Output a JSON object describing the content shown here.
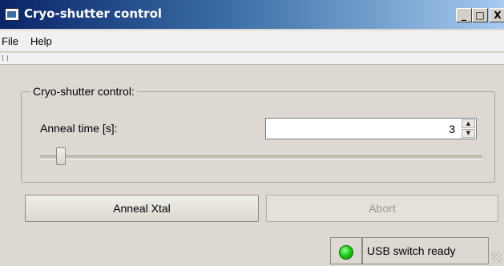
{
  "window": {
    "title": "Cryo-shutter control",
    "min_label": "_",
    "max_label": "□",
    "close_label": "X"
  },
  "menu": {
    "file": "File",
    "help": "Help"
  },
  "group": {
    "title": "Cryo-shutter control:",
    "anneal_label": "Anneal time [s]:",
    "anneal_value": "3",
    "spin_up": "▲",
    "spin_down": "▼"
  },
  "buttons": {
    "anneal": "Anneal Xtal",
    "abort": "Abort"
  },
  "status": {
    "text": "USB switch ready",
    "led_color": "#1bd01b"
  },
  "slider": {
    "value": 3
  }
}
